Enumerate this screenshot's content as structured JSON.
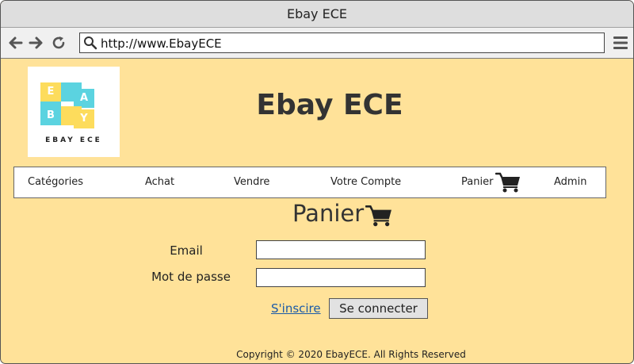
{
  "browser": {
    "window_title": "Ebay ECE",
    "url": "http://www.EbayECE",
    "icons": [
      "back-arrow-icon",
      "forward-arrow-icon",
      "reload-icon",
      "search-icon",
      "hamburger-menu-icon"
    ]
  },
  "logo": {
    "letters": [
      "E",
      "A",
      "B",
      "Y"
    ],
    "caption": "EBAY ECE",
    "colors": {
      "yellow": "#fddc5c",
      "cyan": "#5bd3e0"
    }
  },
  "header": {
    "title": "Ebay ECE"
  },
  "nav": {
    "items": [
      "Catégories",
      "Achat",
      "Vendre",
      "Votre Compte",
      "Panier",
      "Admin"
    ]
  },
  "main": {
    "heading": "Panier",
    "email_label": "Email",
    "email_value": "",
    "password_label": "Mot de passe",
    "password_value": "",
    "signup_link": "S'inscire",
    "login_button": "Se connecter"
  },
  "footer": {
    "text": "Copyright  © 2020 EbayECE. All Rights Reserved"
  },
  "colors": {
    "page_background": "#ffe299",
    "link": "#1a5aa8",
    "text": "#333333"
  }
}
